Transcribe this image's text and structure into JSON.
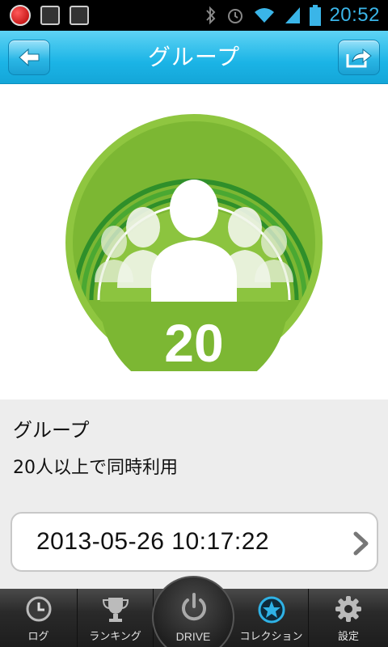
{
  "statusbar": {
    "time": "20:52"
  },
  "header": {
    "title": "グループ"
  },
  "badge": {
    "count": "20",
    "colors": {
      "outer": "#8fc640",
      "inner": "#7bb832",
      "stripe": "#3d9a2e",
      "figure": "#ffffff"
    }
  },
  "info": {
    "title": "グループ",
    "description": "20人以上で同時利用",
    "datetime": "2013-05-26 10:17:22"
  },
  "nav": {
    "tabs": [
      {
        "label": "ログ",
        "icon": "clock-icon"
      },
      {
        "label": "ランキング",
        "icon": "trophy-icon"
      },
      {
        "label": "DRIVE",
        "icon": "power-icon"
      },
      {
        "label": "コレクション",
        "icon": "star-icon"
      },
      {
        "label": "設定",
        "icon": "gear-icon"
      }
    ]
  }
}
